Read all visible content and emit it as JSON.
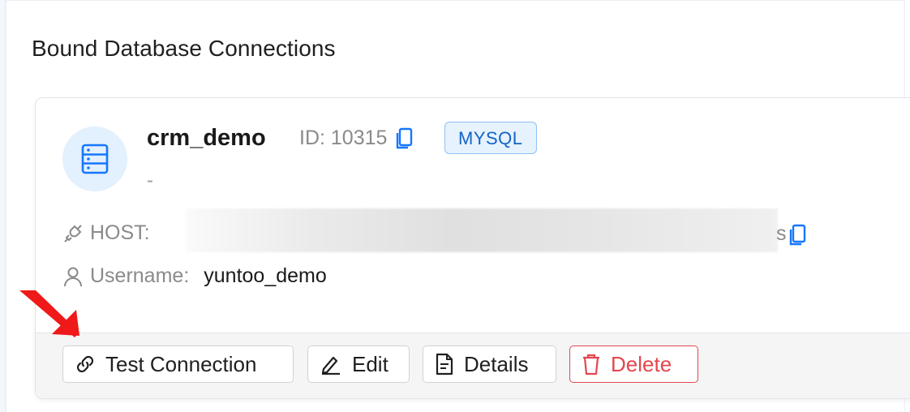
{
  "section": {
    "title": "Bound Database Connections"
  },
  "connection": {
    "name": "crm_demo",
    "id_label": "ID: 10315",
    "type_tag": "MYSQL",
    "description": "-",
    "host_label": "HOST:",
    "host_value_tail": "s",
    "username_label": "Username:",
    "username_value": "yuntoo_demo"
  },
  "actions": {
    "test_label": "Test Connection",
    "edit_label": "Edit",
    "details_label": "Details",
    "delete_label": "Delete"
  },
  "colors": {
    "accent": "#1464c8",
    "danger": "#e5464e",
    "annotation_arrow": "#f01919"
  },
  "icons": {
    "avatar": "database-server-icon",
    "copy": "copy-icon",
    "host": "plug-icon",
    "user": "user-icon",
    "test": "link-icon",
    "edit": "pen-icon",
    "details": "document-icon",
    "delete": "trash-icon"
  }
}
